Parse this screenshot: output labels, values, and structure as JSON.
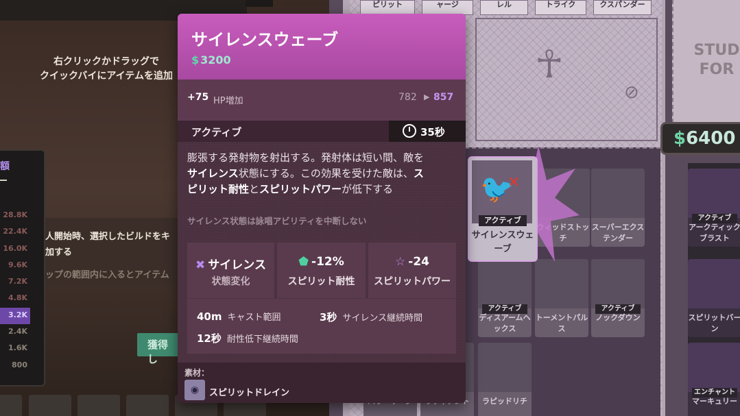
{
  "left_panel": {
    "hint_line1": "右クリックかドラッグで",
    "hint_line2": "クイックバイにアイテムを追加",
    "build_title": "額",
    "prices": [
      "28.8K",
      "22.4K",
      "16.0K",
      "9.6K",
      "7.2K",
      "4.8K",
      "3.2K",
      "2.4K",
      "1.6K",
      "800"
    ],
    "selected_price_index": 6,
    "note_line1": "人開始時、選択したビルドをキ",
    "note_line2": "加する",
    "note_line3": "ップの範囲内に入るとアイテム",
    "acquire_button": "獲得し"
  },
  "shop": {
    "top_tabs": [
      "ピリット",
      "ャージ",
      "レル",
      "トライク",
      "クスパンダー"
    ],
    "study_text": "STUD FOR",
    "souls_badge": "6400",
    "hovered_item": {
      "tag": "アクティブ",
      "name": "サイレンスウェーブ"
    },
    "items": [
      {
        "name": "ウィッドストッチ",
        "tag": ""
      },
      {
        "name": "スーパーエクステンダー",
        "tag": ""
      },
      {
        "name": "アークティックブラスト",
        "tag": "アクティブ"
      },
      {
        "name": "ディスアームヘックス",
        "tag": "アクティブ"
      },
      {
        "name": "トーメントパルス",
        "tag": ""
      },
      {
        "name": "ノックダウン",
        "tag": "アクティブ"
      },
      {
        "name": "スピリットバーン",
        "tag": ""
      },
      {
        "name": "パワーサージ",
        "tag": ""
      },
      {
        "name": "ラディアント",
        "tag": ""
      },
      {
        "name": "ラピッドリチ",
        "tag": ""
      },
      {
        "name": "マーキュリー",
        "tag": "エンチャント"
      }
    ]
  },
  "tooltip": {
    "title": "サイレンスウェーブ",
    "cost": "3200",
    "stat_bonus": "+75",
    "stat_label": "HP増加",
    "stat_from": "782",
    "stat_to": "857",
    "active_label": "アクティブ",
    "cooldown": "35秒",
    "desc": {
      "p1": "膨張する発射物を射出する。発射体は短い間、敵を",
      "p2_b": "サイレンス",
      "p2": "状態にする。この効果を受けた敵は、",
      "p2_b2": "ス",
      "p3_b": "ピリット耐性",
      "p3": "と",
      "p3_b2": "スピリットパワー",
      "p3_end": "が低下する"
    },
    "subnote": "サイレンス状態は詠唱アビリティを中断しない",
    "effects": [
      {
        "main": "サイレンス",
        "sub": "状態変化",
        "icon": "silence-icon"
      },
      {
        "main": "-12%",
        "sub": "スピリット耐性",
        "icon": "spirit-shield-icon"
      },
      {
        "main": "-24",
        "sub": "スピリットパワー",
        "icon": "spirit-star-icon"
      }
    ],
    "props": [
      {
        "value": "40m",
        "label": "キャスト範囲"
      },
      {
        "value": "3秒",
        "label": "サイレンス継続時間"
      },
      {
        "value": "12秒",
        "label": "耐性低下継続時間"
      }
    ],
    "component_label": "素材：",
    "component_name": "スピリットドレイン"
  }
}
